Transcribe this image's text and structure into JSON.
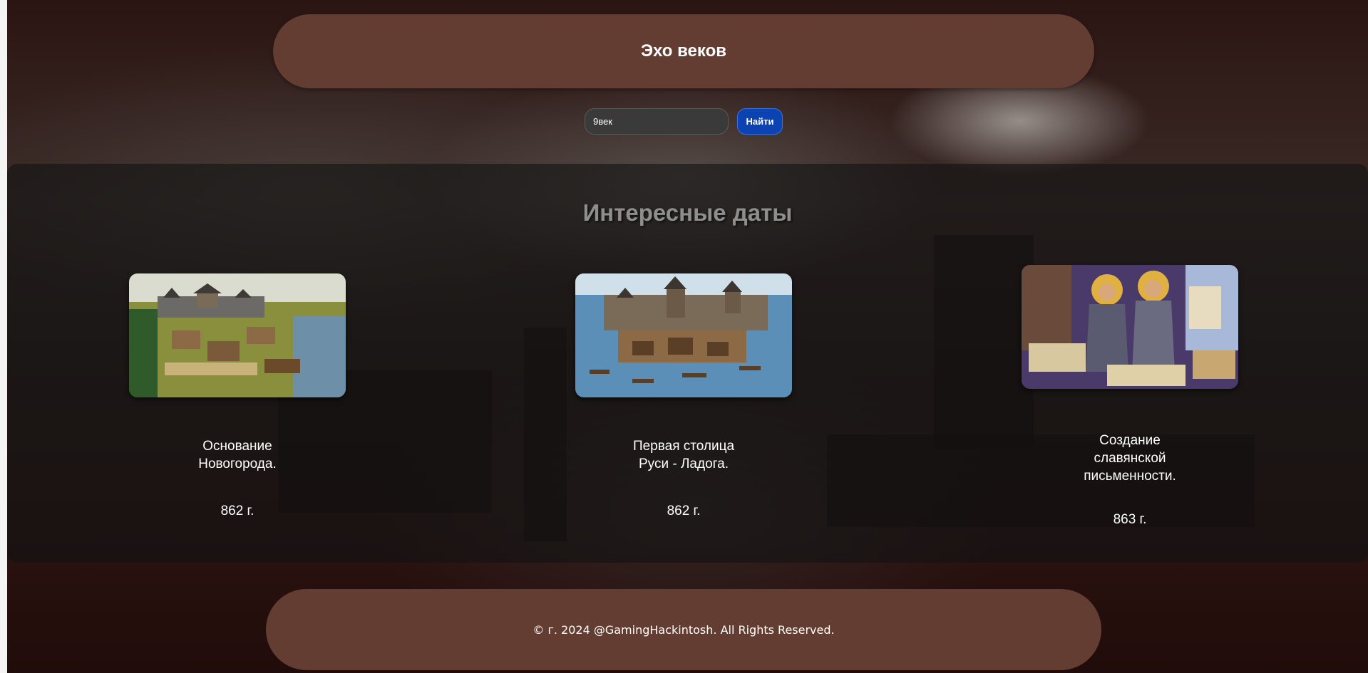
{
  "header": {
    "title": "Эхо веков"
  },
  "search": {
    "value": "9век",
    "button_label": "Найти"
  },
  "dates_section": {
    "title": "Интересные даты",
    "cards": [
      {
        "caption": "Основание Новогорода.",
        "year": "862 г.",
        "image_icon": "novgorod-settlement-illustration"
      },
      {
        "caption": "Первая столица Руси - Ладога.",
        "year": "862 г.",
        "image_icon": "ladoga-fortress-illustration"
      },
      {
        "caption": "Создание славянской письменности.",
        "year": "863 г.",
        "image_icon": "cyril-methodius-scholars-illustration"
      }
    ]
  },
  "footer": {
    "text": "© г. 2024 @GamingHackintosh. All Rights Reserved."
  },
  "colors": {
    "header_bg": "#633d32",
    "footer_bg": "#633d32",
    "button_bg": "#0b43b3",
    "input_bg": "#3a3a3a",
    "section_title": "#8e8e8e"
  }
}
